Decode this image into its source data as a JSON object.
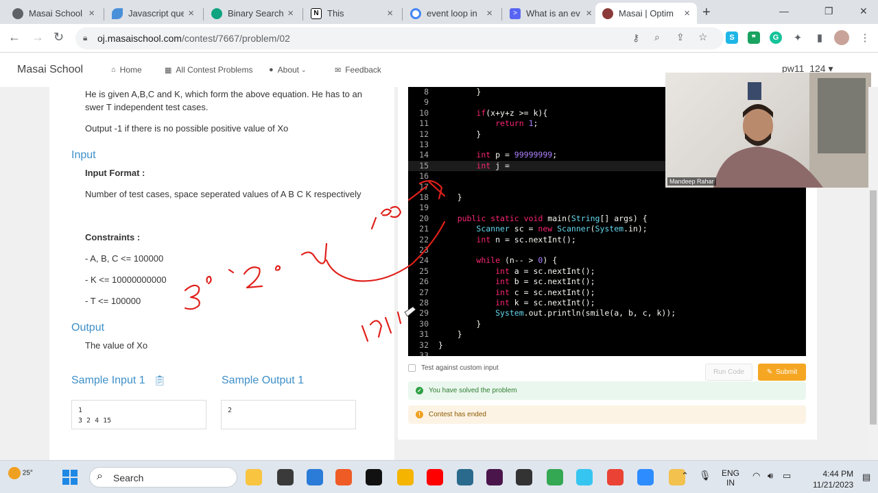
{
  "browser": {
    "tabs": [
      {
        "title": "Masai School |",
        "favicon_color": "#5f6368"
      },
      {
        "title": "Javascript que",
        "favicon_color": "#4a90d9"
      },
      {
        "title": "Binary Search",
        "favicon_color": "#10a37f"
      },
      {
        "title": "This",
        "favicon_color": "#000000"
      },
      {
        "title": "event loop in",
        "favicon_color": "#4285f4"
      },
      {
        "title": "What is an ev",
        "favicon_color": "#5865f2"
      },
      {
        "title": "Masai | Optim",
        "favicon_color": "#8b3a3a"
      }
    ],
    "url_host": "oj.masaischool.com",
    "url_path": "/contest/7667/problem/02"
  },
  "site": {
    "brand": "Masai School",
    "nav": [
      {
        "label": "Home",
        "icon": "home-icon"
      },
      {
        "label": "All Contest Problems",
        "icon": "grid-icon"
      },
      {
        "label": "About",
        "icon": "info-icon"
      },
      {
        "label": "Feedback",
        "icon": "feedback-icon"
      }
    ],
    "user": "pw11_124 ▾"
  },
  "problem": {
    "desc_line1": "He is given A,B,C and K, which form the above equation. He has to an",
    "desc_line2": "swer T independent test cases.",
    "output_note": "Output -1 if there is no possible positive value of Xo",
    "input_heading": "Input",
    "input_format_label": "Input Format :",
    "input_format_text": "Number of test cases, space seperated values of A B C K respectively",
    "constraints_label": "Constraints :",
    "constraints": [
      "- A, B, C <= 100000",
      "- K <= 10000000000",
      "- T <= 100000"
    ],
    "output_heading": "Output",
    "output_text": "The value of Xo",
    "sample_input_heading": "Sample Input 1",
    "sample_output_heading": "Sample Output 1",
    "sample_input_lines": [
      "1",
      "3 2 4 15"
    ],
    "sample_output_lines": [
      "2"
    ]
  },
  "editor": {
    "lines": [
      {
        "n": "8",
        "code": "        }"
      },
      {
        "n": "9",
        "code": ""
      },
      {
        "n": "10",
        "code": "        if(x+y+z >= k){"
      },
      {
        "n": "11",
        "code": "            return 1;"
      },
      {
        "n": "12",
        "code": "        }"
      },
      {
        "n": "13",
        "code": ""
      },
      {
        "n": "14",
        "code": "        int p = 99999999;"
      },
      {
        "n": "15",
        "code": "        int j = "
      },
      {
        "n": "16",
        "code": ""
      },
      {
        "n": "17",
        "code": ""
      },
      {
        "n": "18",
        "code": "    }"
      },
      {
        "n": "19",
        "code": ""
      },
      {
        "n": "20",
        "code": "    public static void main(String[] args) {"
      },
      {
        "n": "21",
        "code": "        Scanner sc = new Scanner(System.in);"
      },
      {
        "n": "22",
        "code": "        int n = sc.nextInt();"
      },
      {
        "n": "23",
        "code": ""
      },
      {
        "n": "24",
        "code": "        while (n-- > 0) {"
      },
      {
        "n": "25",
        "code": "            int a = sc.nextInt();"
      },
      {
        "n": "26",
        "code": "            int b = sc.nextInt();"
      },
      {
        "n": "27",
        "code": "            int c = sc.nextInt();"
      },
      {
        "n": "28",
        "code": "            int k = sc.nextInt();"
      },
      {
        "n": "29",
        "code": "            System.out.println(smile(a, b, c, k));"
      },
      {
        "n": "30",
        "code": "        }"
      },
      {
        "n": "31",
        "code": "    }"
      },
      {
        "n": "32",
        "code": "}"
      },
      {
        "n": "33",
        "code": ""
      }
    ],
    "highlighted_line": "15"
  },
  "actions": {
    "custom_input_label": "Test against custom input",
    "run_label": "Run Code",
    "submit_label": "Submit",
    "solved_text": "You have solved the problem",
    "ended_text": "Contest has ended"
  },
  "webcam": {
    "name": "Mandeep Rahar"
  },
  "taskbar": {
    "temperature": "25°",
    "search_label": "Search",
    "lang_line1": "ENG",
    "lang_line2": "IN",
    "time": "4:44 PM",
    "date": "11/21/2023",
    "apps": [
      {
        "name": "windows-start-icon",
        "color": "#1e88e5"
      },
      {
        "name": "file-explorer-icon",
        "color": "#f9c440"
      },
      {
        "name": "app-dark-icon",
        "color": "#3a3a3a"
      },
      {
        "name": "ms-store-icon",
        "color": "#2b7bd8"
      },
      {
        "name": "postman-icon",
        "color": "#ef5b25"
      },
      {
        "name": "obs-record-icon",
        "color": "#111111"
      },
      {
        "name": "chrome-canary-icon",
        "color": "#f4b400"
      },
      {
        "name": "youtube-icon",
        "color": "#ff0000"
      },
      {
        "name": "mysql-icon",
        "color": "#2a6a8c"
      },
      {
        "name": "slack-icon",
        "color": "#4a154b"
      },
      {
        "name": "m-app-icon",
        "color": "#333333"
      },
      {
        "name": "chrome-icon",
        "color": "#34a853"
      },
      {
        "name": "slack-alt-icon",
        "color": "#36c5f0"
      },
      {
        "name": "gmail-icon",
        "color": "#ea4335"
      },
      {
        "name": "zoom-icon",
        "color": "#2d8cff"
      },
      {
        "name": "folder-icon",
        "color": "#f2c14e"
      }
    ]
  },
  "colors": {
    "accent_blue": "#3d8fc8",
    "submit_orange": "#f5a623",
    "success_green": "#eaf7ee",
    "warning_orange": "#fdf3e5",
    "ink_red": "#e0201b"
  }
}
